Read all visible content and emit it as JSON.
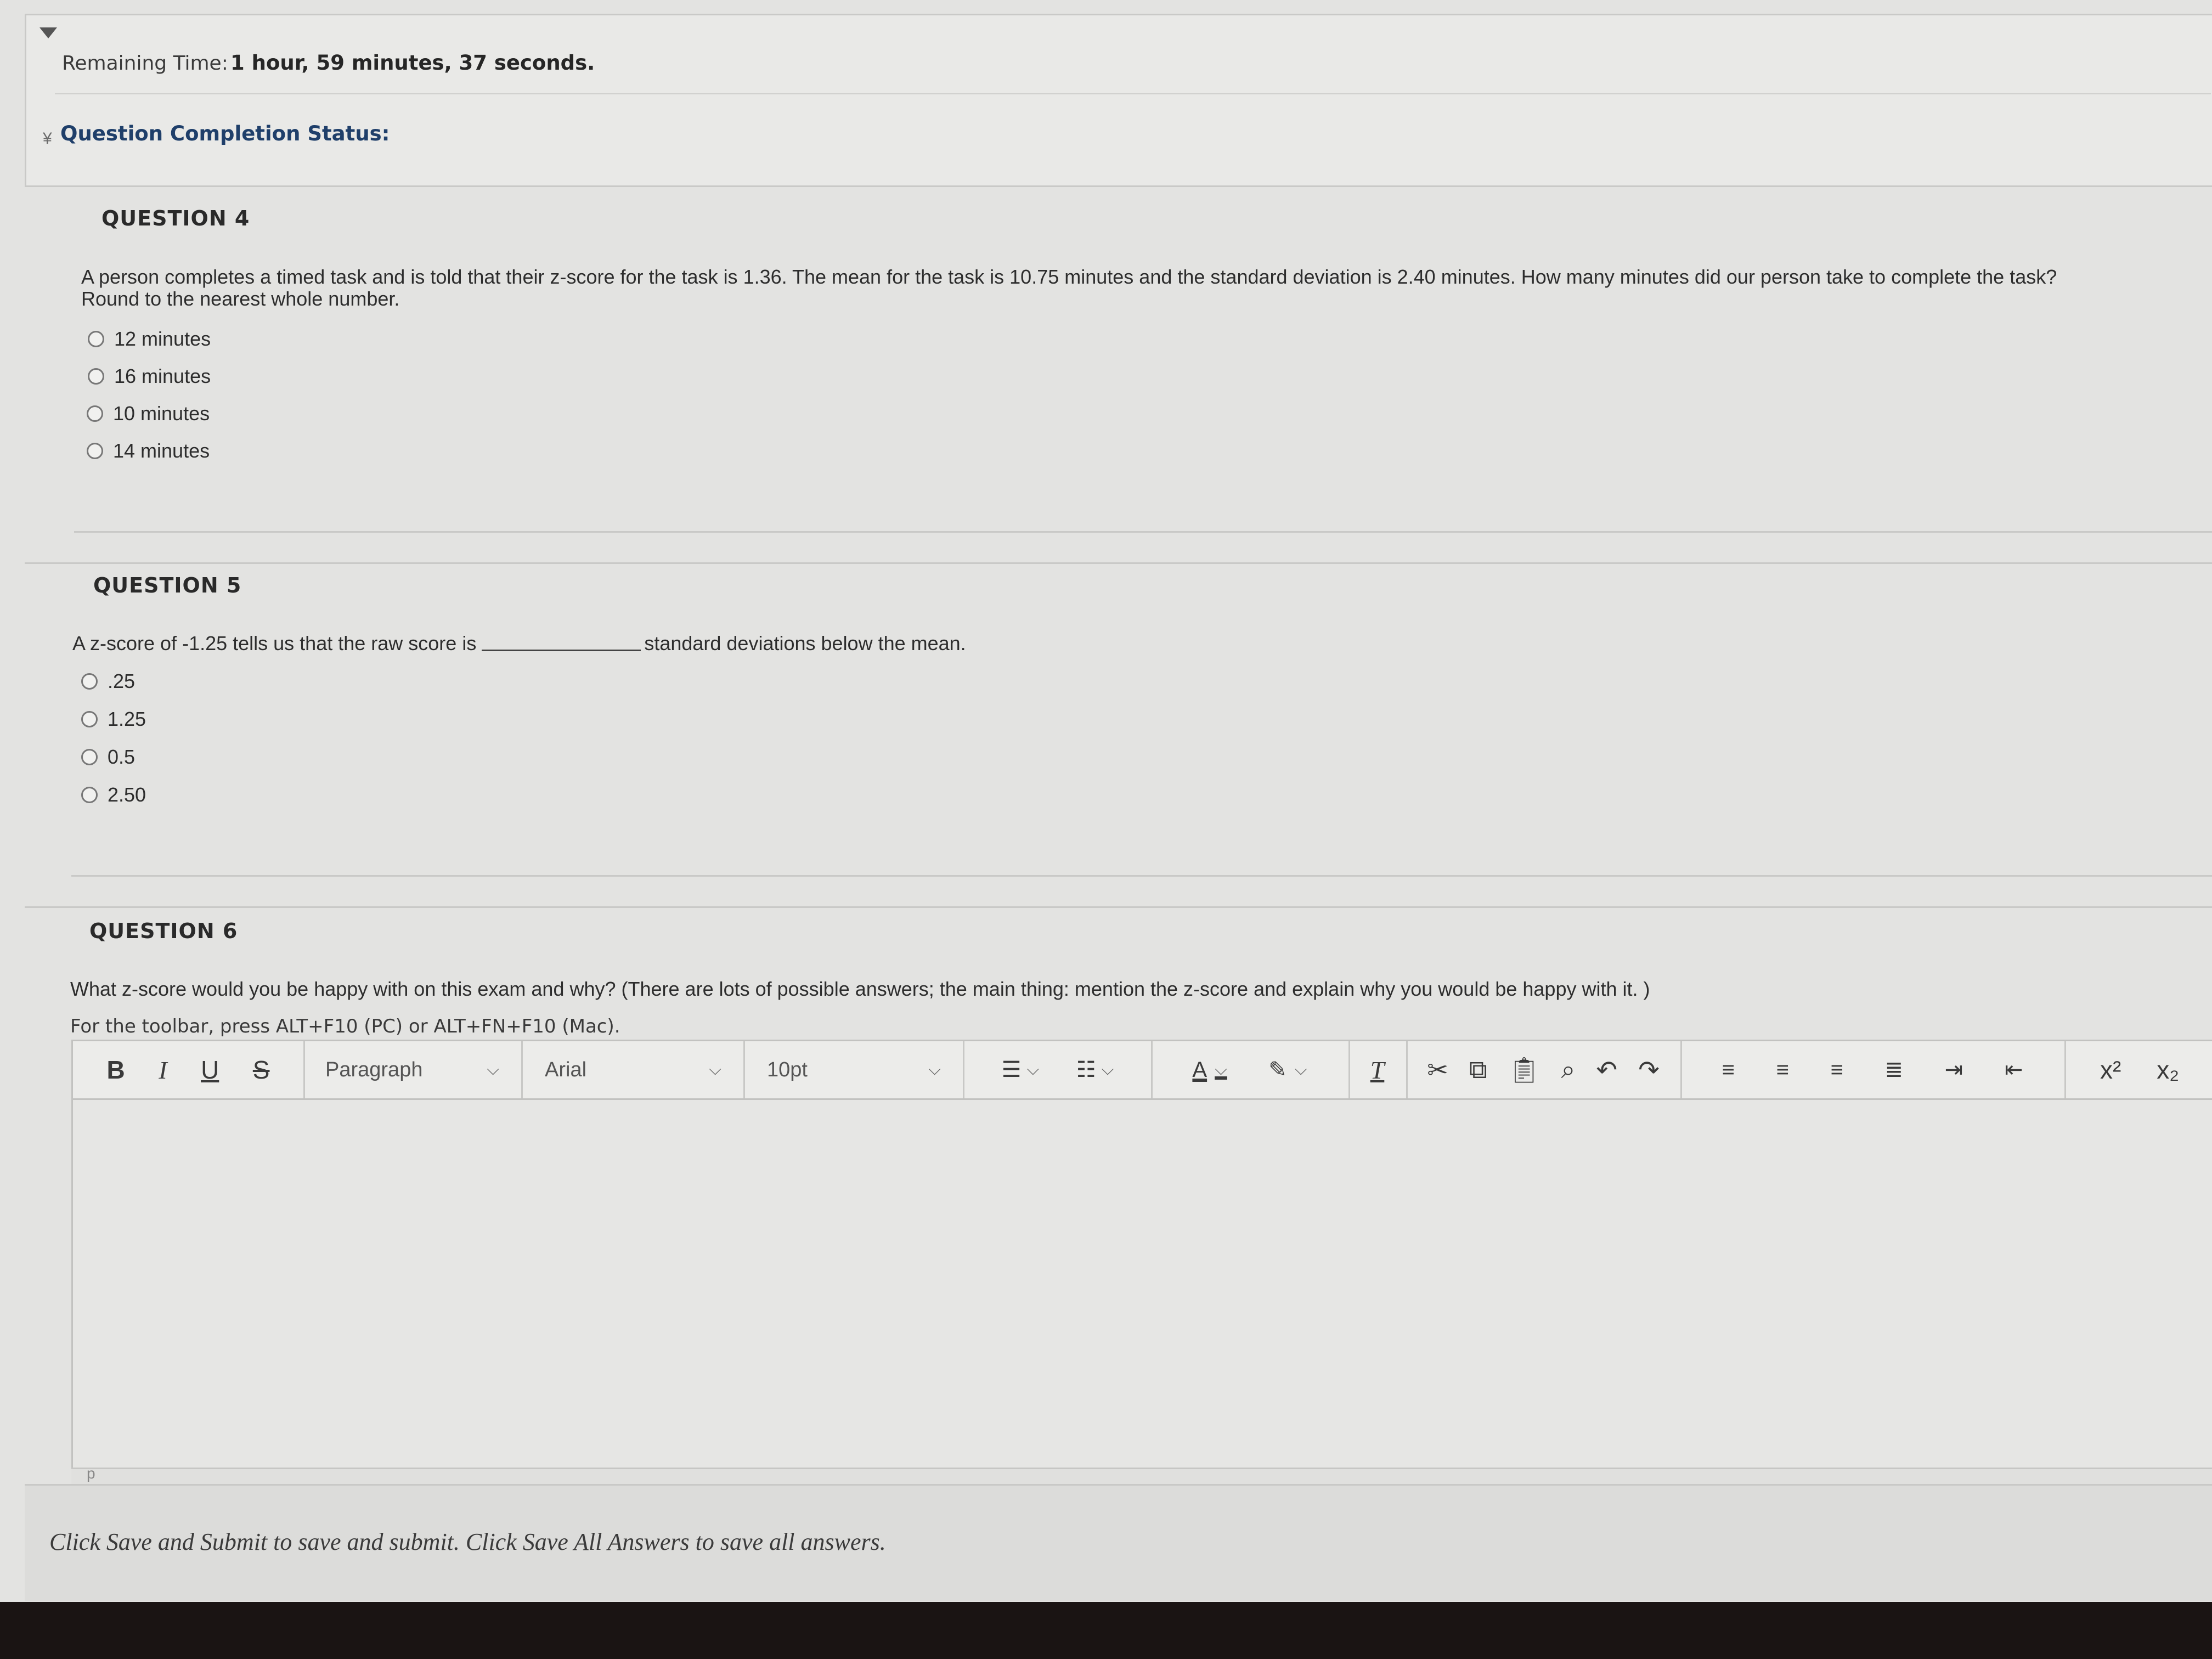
{
  "header": {
    "timer_label": "Remaining Time:",
    "timer_value": "1 hour, 59 minutes, 37 seconds.",
    "status_label": "Question Completion Status:"
  },
  "questions": [
    {
      "title": "QUESTION 4",
      "text_line1": "A person completes a timed task and is told that their z-score for the task is 1.36. The mean for the task is 10.75 minutes and the standard deviation is 2.40 minutes. How many minutes did our person take to complete the task?",
      "text_line2": "Round to the nearest whole number.",
      "options": [
        "12 minutes",
        "16 minutes",
        "10 minutes",
        "14 minutes"
      ]
    },
    {
      "title": "QUESTION 5",
      "text_before": "A z-score of -1.25 tells us that the raw score is",
      "text_after": "standard deviations below the mean.",
      "options": [
        ".25",
        "1.25",
        "0.5",
        "2.50"
      ]
    },
    {
      "title": "QUESTION 6",
      "text": "What z-score would you be happy with on this exam and why?  (There are lots of possible answers; the main thing: mention the z-score and explain why you would be happy with it. )",
      "toolbar_hint": "For the toolbar, press ALT+F10 (PC) or ALT+FN+F10 (Mac)."
    }
  ],
  "editor": {
    "bold": "B",
    "italic": "I",
    "underline": "U",
    "strike": "S",
    "paragraph": "Paragraph",
    "font": "Arial",
    "size": "10pt",
    "text_color": "A",
    "clear_format": "T",
    "superscript": "x²",
    "subscript": "x₂",
    "path": "p"
  },
  "footer": {
    "note": "Click Save and Submit to save and submit. Click Save All Answers to save all answers."
  }
}
